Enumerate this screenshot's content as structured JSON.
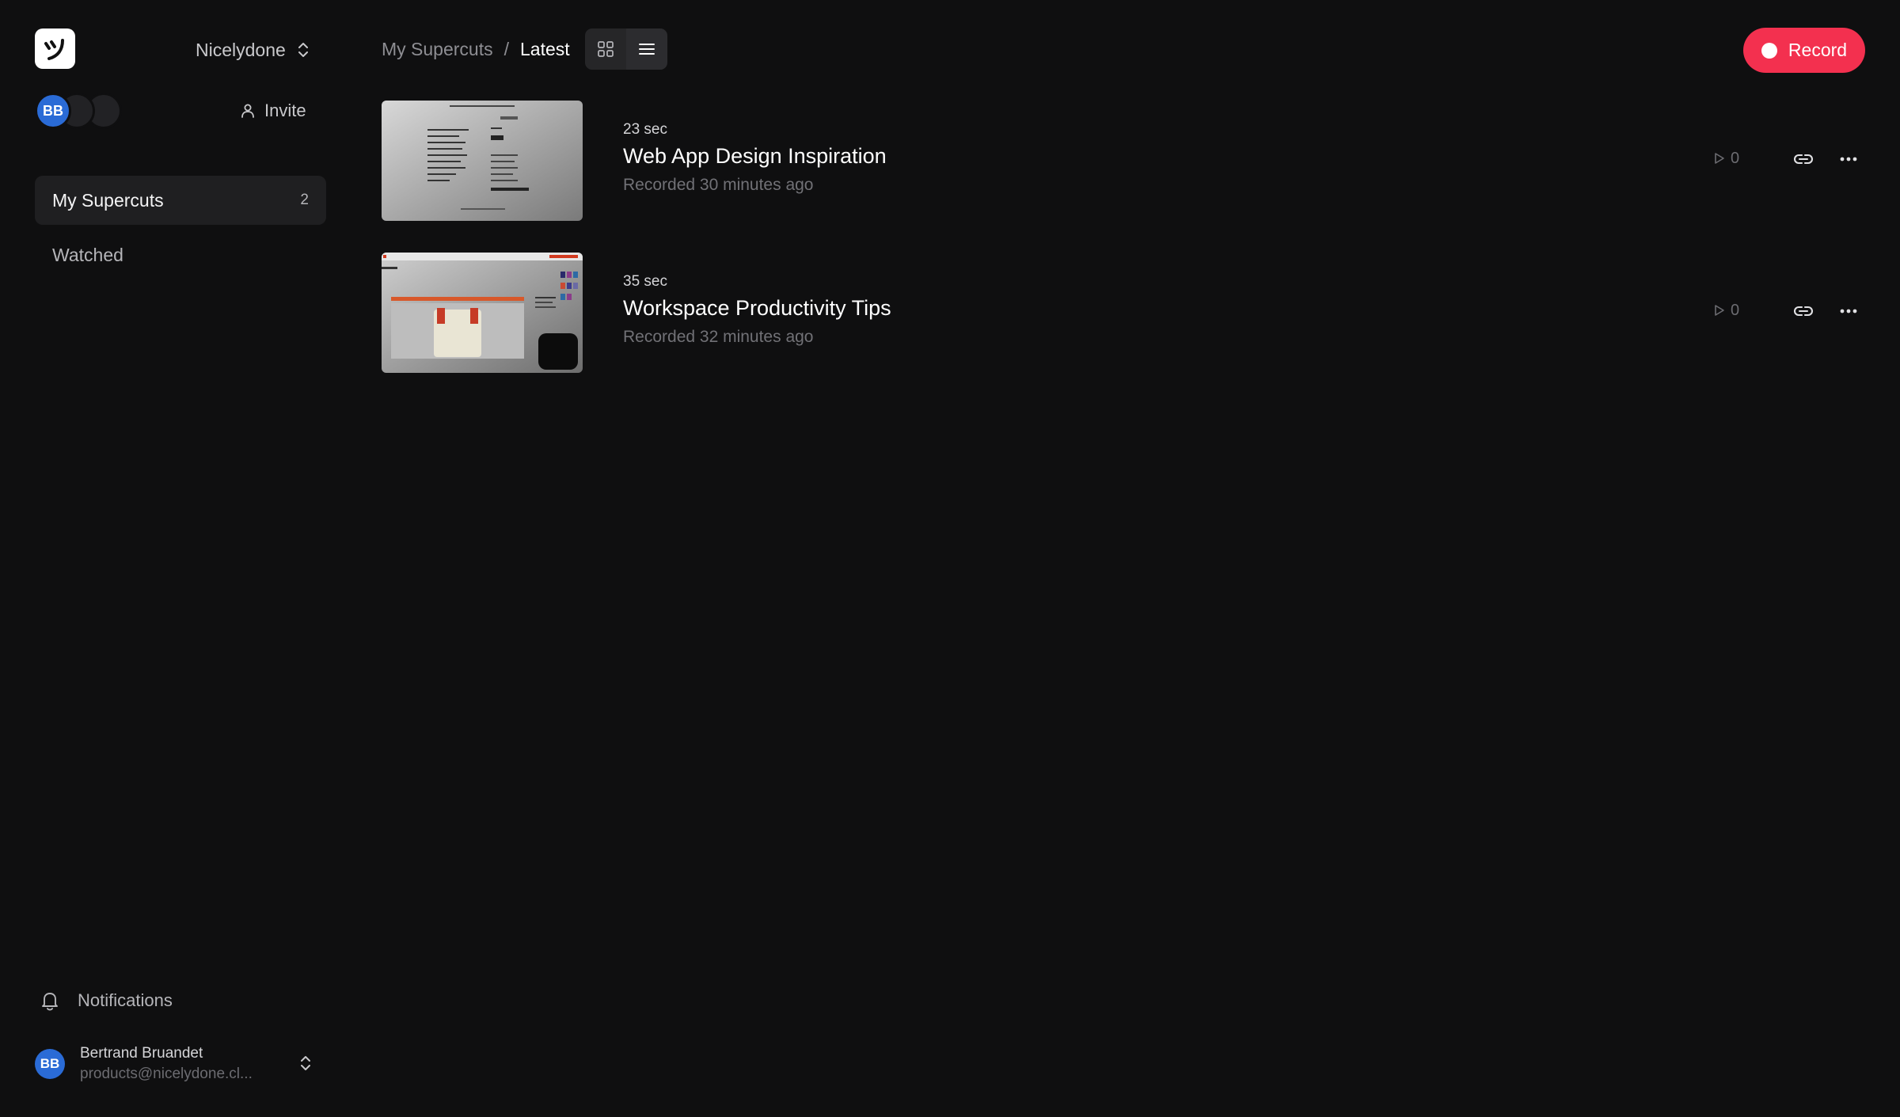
{
  "sidebar": {
    "workspace_name": "Nicelydone",
    "avatar_initials": "BB",
    "invite_label": "Invite",
    "nav": [
      {
        "label": "My Supercuts",
        "count": "2"
      },
      {
        "label": "Watched"
      }
    ],
    "notifications_label": "Notifications",
    "user": {
      "initials": "BB",
      "name": "Bertrand Bruandet",
      "email": "products@nicelydone.cl..."
    }
  },
  "header": {
    "breadcrumb_parent": "My Supercuts",
    "breadcrumb_separator": "/",
    "breadcrumb_current": "Latest",
    "record_label": "Record"
  },
  "videos": [
    {
      "duration": "23 sec",
      "title": "Web App Design Inspiration",
      "recorded": "Recorded 30 minutes ago",
      "views": "0"
    },
    {
      "duration": "35 sec",
      "title": "Workspace Productivity Tips",
      "recorded": "Recorded 32 minutes ago",
      "views": "0"
    }
  ],
  "colors": {
    "background": "#0f0f10",
    "accent_record": "#f3304f",
    "avatar_blue": "#2a6bd6",
    "active_nav": "#1f1f21"
  }
}
